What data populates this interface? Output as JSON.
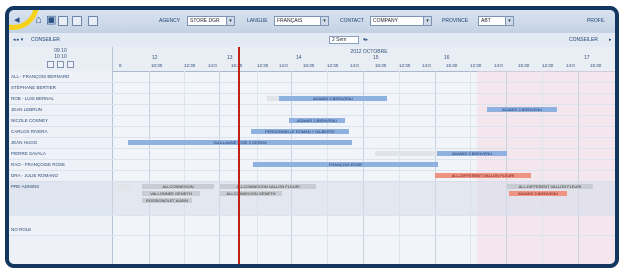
{
  "toolbar": {
    "filters": [
      {
        "label": "AGENCY",
        "value": "STORE DGR"
      },
      {
        "label": "LANGUE",
        "value": "FRANÇAIS"
      },
      {
        "label": "CONTACT",
        "value": "COMPANY"
      },
      {
        "label": "PROVINCE",
        "value": "ABT"
      }
    ],
    "right_link": "PROFIL"
  },
  "nav": {
    "prev_label": "◂ ▸ ▾",
    "prev_text": "CONSEILER",
    "view_select": "2 Sem",
    "next_text": "CONSEILER",
    "next_arrow": "▸"
  },
  "header": {
    "left_day": "09 10",
    "left_sub": "10 10",
    "center_title": "2012 OCTOBRE",
    "days": [
      "12",
      "13",
      "14",
      "15",
      "16",
      "17"
    ],
    "ticks": [
      "8",
      "10:30",
      "12:30",
      "14:0",
      "16:30",
      "12:30",
      "14:0",
      "16:30",
      "12:30",
      "14:0",
      "16:30",
      "12:30",
      "14:0",
      "16:30",
      "12:30",
      "14:0",
      "16:30",
      "12:30",
      "14:0",
      "16:30"
    ]
  },
  "rows": [
    {
      "name": "ALL - FRANÇOIS BERNARD"
    },
    {
      "name": "STÉPHANE BERTIER"
    },
    {
      "name": "ROB - LUIS BERNAL"
    },
    {
      "name": "JEAN LEBRUN"
    },
    {
      "name": "NICOLE COSNEY"
    },
    {
      "name": "CARLOS RIVERA"
    },
    {
      "name": "JEAN HUGO"
    },
    {
      "name": "PIERRE SAVALA"
    },
    {
      "name": "RAO - FRANÇOISE ROSE"
    },
    {
      "name": "DRA - JULIE ROMANO"
    },
    {
      "name": "PRE-ADMINS"
    },
    {
      "name": "NO ROLE"
    }
  ],
  "bars": [
    {
      "label": "",
      "style": "light"
    },
    {
      "label": "ADAMIS 3 BIENVENU",
      "style": "blue"
    },
    {
      "label": "ADAMIS 3 BIENVENU",
      "style": "blue"
    },
    {
      "label": "ADAMIS 3 BIENVENU",
      "style": "blue"
    },
    {
      "label": "PERSONNELLE ROMAN + GILBERTE",
      "style": "blue"
    },
    {
      "label": "GUILLAUME VOIR 3 GEREM",
      "style": "blue"
    },
    {
      "label": "",
      "style": "light"
    },
    {
      "label": "ADAMIS 3 BIENVENU",
      "style": "blue"
    },
    {
      "label": "FRANÇOIS ROSE",
      "style": "blue"
    },
    {
      "label": "ALL-DIFFERENT VALLON FLEURI",
      "style": "red"
    },
    {
      "label": "ALLCONNEXION",
      "style": "gray"
    },
    {
      "label": "VALLONNEE GENETH",
      "style": "gray"
    },
    {
      "label": "ROSSIGNOLET AUBIN",
      "style": "gray"
    },
    {
      "label": "ALLCONNEXION VALLON FLEURI",
      "style": "gray"
    },
    {
      "label": "ALLCONNEXION GENETH",
      "style": "gray"
    },
    {
      "label": "ALL-DIFFERENT VALLON FLEURI",
      "style": "gray"
    },
    {
      "label": "ADAMIS 3 BIENVENU",
      "style": "red"
    }
  ],
  "colors": {
    "frame": "#14375f",
    "highlight_circle": "#f6d21c",
    "now_line": "#c02316",
    "bar_blue": "#8fb1e0",
    "bar_red": "#ef9383"
  }
}
